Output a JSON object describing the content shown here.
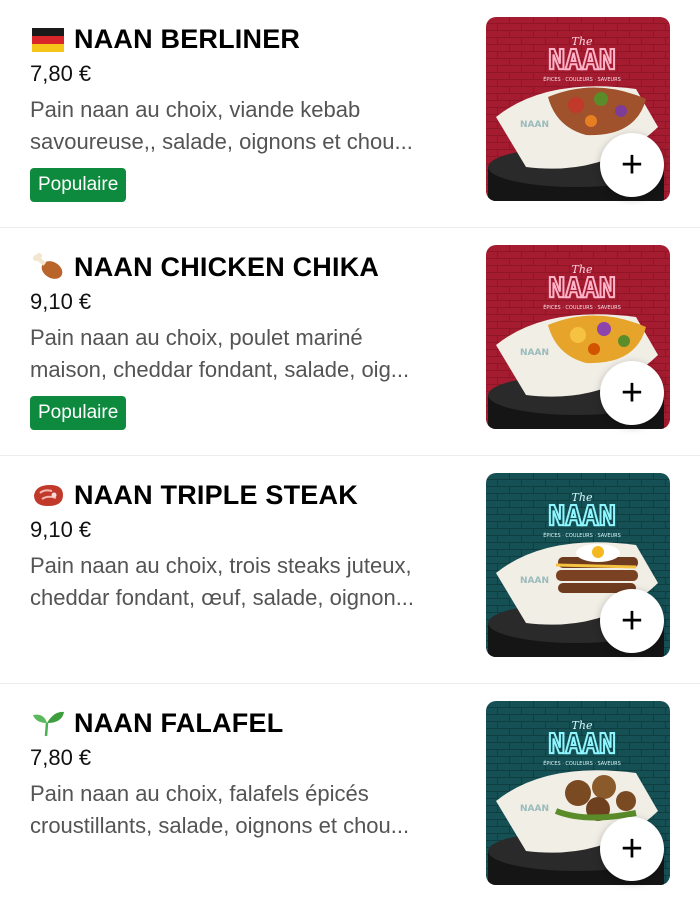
{
  "items": [
    {
      "title": "NAAN BERLINER",
      "price": "7,80 €",
      "desc_line1": "Pain naan au choix, viande kebab",
      "desc_line2": "savoureuse,, salade, oignons et chou...",
      "badge": "Populaire",
      "icon": "german-flag-icon",
      "theme": "red",
      "image_brand": "NAAN",
      "image_tagline": "ÉPICES · COULEURS · SAVEURS",
      "add_label": "+"
    },
    {
      "title": "NAAN CHICKEN CHIKA",
      "price": "9,10 €",
      "desc_line1": "Pain naan au choix, poulet mariné",
      "desc_line2": "maison, cheddar fondant, salade, oig...",
      "badge": "Populaire",
      "icon": "chicken-leg-icon",
      "theme": "red",
      "image_brand": "NAAN",
      "image_tagline": "ÉPICES · COULEURS · SAVEURS",
      "add_label": "+"
    },
    {
      "title": "NAAN TRIPLE STEAK",
      "price": "9,10 €",
      "desc_line1": "Pain naan au choix, trois steaks juteux,",
      "desc_line2": "cheddar fondant, œuf, salade, oignon...",
      "badge": "",
      "icon": "steak-icon",
      "theme": "teal",
      "image_brand": "NAAN",
      "image_tagline": "ÉPICES · COULEURS · SAVEURS",
      "add_label": "+"
    },
    {
      "title": "NAAN FALAFEL",
      "price": "7,80 €",
      "desc_line1": "Pain naan au choix, falafels épicés",
      "desc_line2": "croustillants, salade, oignons et chou...",
      "badge": "",
      "icon": "seedling-icon",
      "theme": "teal",
      "image_brand": "NAAN",
      "image_tagline": "ÉPICES · COULEURS · SAVEURS",
      "add_label": "+"
    }
  ],
  "colors": {
    "badge_bg": "#0e8a3e",
    "desc_text": "#545454",
    "red_wall": "#8e1626",
    "teal_wall": "#0f3d40",
    "neon_pink": "#ff9fc0",
    "neon_cyan": "#8ff6ff"
  }
}
